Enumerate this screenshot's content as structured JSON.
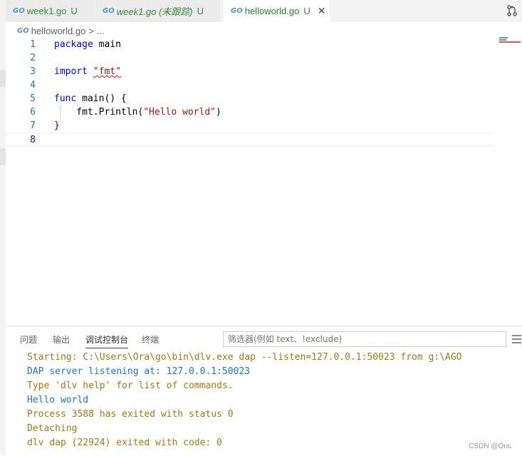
{
  "tabs": [
    {
      "go": "GO",
      "label": "week1.go",
      "status": "U",
      "italic": false
    },
    {
      "go": "GO",
      "label": "week1.go (未跟踪)",
      "status": "U",
      "italic": true
    },
    {
      "go": "GO",
      "label": "helloworld.go",
      "status": "U",
      "close": "✕",
      "active": true
    }
  ],
  "breadcrumb": {
    "go": "GO",
    "file": "helloworld.go",
    "sep": ">",
    "more": "..."
  },
  "editor": {
    "lines": [
      {
        "n": "1",
        "text": "package main"
      },
      {
        "n": "2",
        "text": ""
      },
      {
        "n": "3",
        "text": "import \"fmt\""
      },
      {
        "n": "4",
        "text": ""
      },
      {
        "n": "5",
        "text": "func main() {"
      },
      {
        "n": "6",
        "text": "    fmt.Println(\"Hello world\")"
      },
      {
        "n": "7",
        "text": "}"
      },
      {
        "n": "8",
        "text": ""
      }
    ],
    "tokens": {
      "package": "package",
      "main": " main",
      "import": "import ",
      "fmt": "\"fmt\"",
      "func": "func",
      "main_sig": " main() {",
      "println": "    fmt.Println(",
      "hello": "\"Hello world\"",
      "paren": ")",
      "close": "}"
    }
  },
  "panel": {
    "tabs": [
      "问题",
      "输出",
      "调试控制台",
      "终端"
    ],
    "active_tab": "调试控制台",
    "filter_placeholder": "筛选器(例如 text、!exclude)",
    "console": [
      {
        "text": "Starting: C:\\Users\\Ora\\go\\bin\\dlv.exe dap --listen=127.0.0.1:50023 from g:\\AGO",
        "kind": "warn"
      },
      {
        "text": "DAP server listening at: 127.0.0.1:50023",
        "kind": "info"
      },
      {
        "text": "Type 'dlv help' for list of commands.",
        "kind": "warn"
      },
      {
        "text": "Hello world",
        "kind": "info"
      },
      {
        "text": "Process 3588 has exited with status 0",
        "kind": "warn"
      },
      {
        "text": "Detaching",
        "kind": "warn"
      },
      {
        "text": "dlv dap (22924) exited with code: 0",
        "kind": "warn"
      }
    ]
  },
  "watermark": "CSDN @Ora.",
  "colors": {
    "keyword": "#0000ff",
    "string": "#a31515",
    "line_number": "#237893",
    "console_warn": "#a1790e",
    "console_info": "#1a75d2"
  },
  "icons": [
    "go-file-icon",
    "close-icon",
    "source-control-icon",
    "word-wrap-icon"
  ]
}
